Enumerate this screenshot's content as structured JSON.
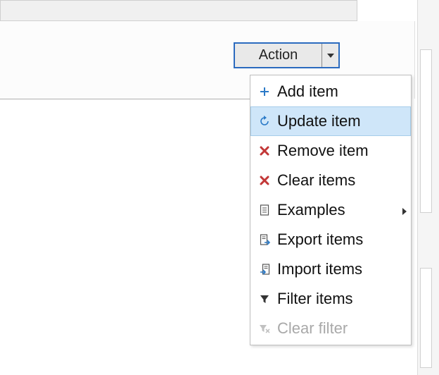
{
  "button": {
    "label": "Action"
  },
  "menu": {
    "items": [
      {
        "label": "Add item"
      },
      {
        "label": "Update item"
      },
      {
        "label": "Remove item"
      },
      {
        "label": "Clear items"
      },
      {
        "label": "Examples"
      },
      {
        "label": "Export items"
      },
      {
        "label": "Import items"
      },
      {
        "label": "Filter items"
      },
      {
        "label": "Clear filter"
      }
    ]
  }
}
